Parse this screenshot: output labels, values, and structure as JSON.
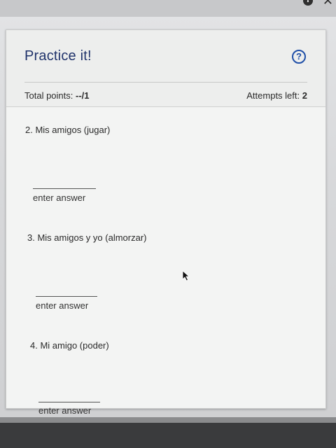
{
  "window": {
    "info_symbol": "i",
    "close_symbol": "✕"
  },
  "panel": {
    "title": "Practice it!",
    "help_symbol": "?",
    "total_points_label": "Total points:",
    "total_points_value": "--/1",
    "attempts_label": "Attempts left:",
    "attempts_value": "2"
  },
  "questions": [
    {
      "prompt": "2. Mis amigos (jugar)",
      "answer_value": "",
      "answer_label": "enter answer"
    },
    {
      "prompt": "3. Mis amigos y yo (almorzar)",
      "answer_value": "",
      "answer_label": "enter answer"
    },
    {
      "prompt": "4. Mi amigo (poder)",
      "answer_value": "",
      "answer_label": "enter answer"
    }
  ],
  "colors": {
    "title": "#20336b",
    "help_icon": "#1f4fa8",
    "card_bg": "#f3f4f3"
  },
  "icons": {
    "help": "question-circle-icon",
    "close": "close-icon",
    "info": "info-icon",
    "cursor": "mouse-pointer-icon"
  }
}
